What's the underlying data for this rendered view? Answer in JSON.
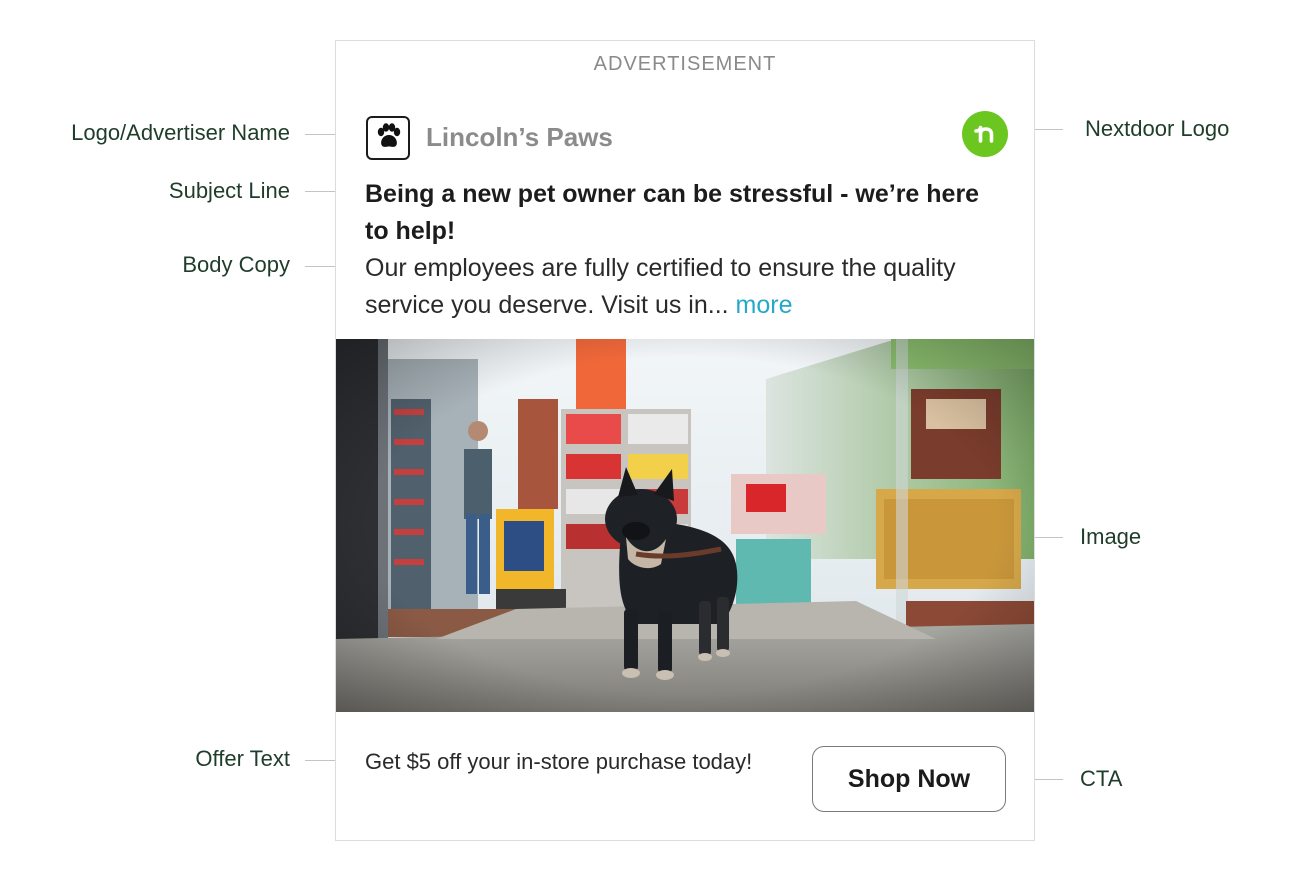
{
  "ad": {
    "label": "ADVERTISEMENT",
    "advertiser_name": "Lincoln’s Paws",
    "advertiser_logo_icon": "paw-icon",
    "platform_logo_icon": "nextdoor-logo-icon",
    "platform_logo_color": "#6bc61f",
    "subject_line": "Being a new pet owner can be stressful - we’re here to help!",
    "body_copy": "Our employees are fully certified to ensure the quality service you deserve. Visit us in...",
    "more_label": "more",
    "more_color": "#26a8c7",
    "offer_text": "Get $5 off your in-store purchase today!",
    "cta_label": "Shop Now"
  },
  "annotations": {
    "logo_advertiser_name": "Logo/Advertiser Name",
    "subject_line": "Subject Line",
    "body_copy": "Body Copy",
    "offer_text": "Offer Text",
    "nextdoor_logo": "Nextdoor Logo",
    "image": "Image",
    "cta": "CTA"
  }
}
